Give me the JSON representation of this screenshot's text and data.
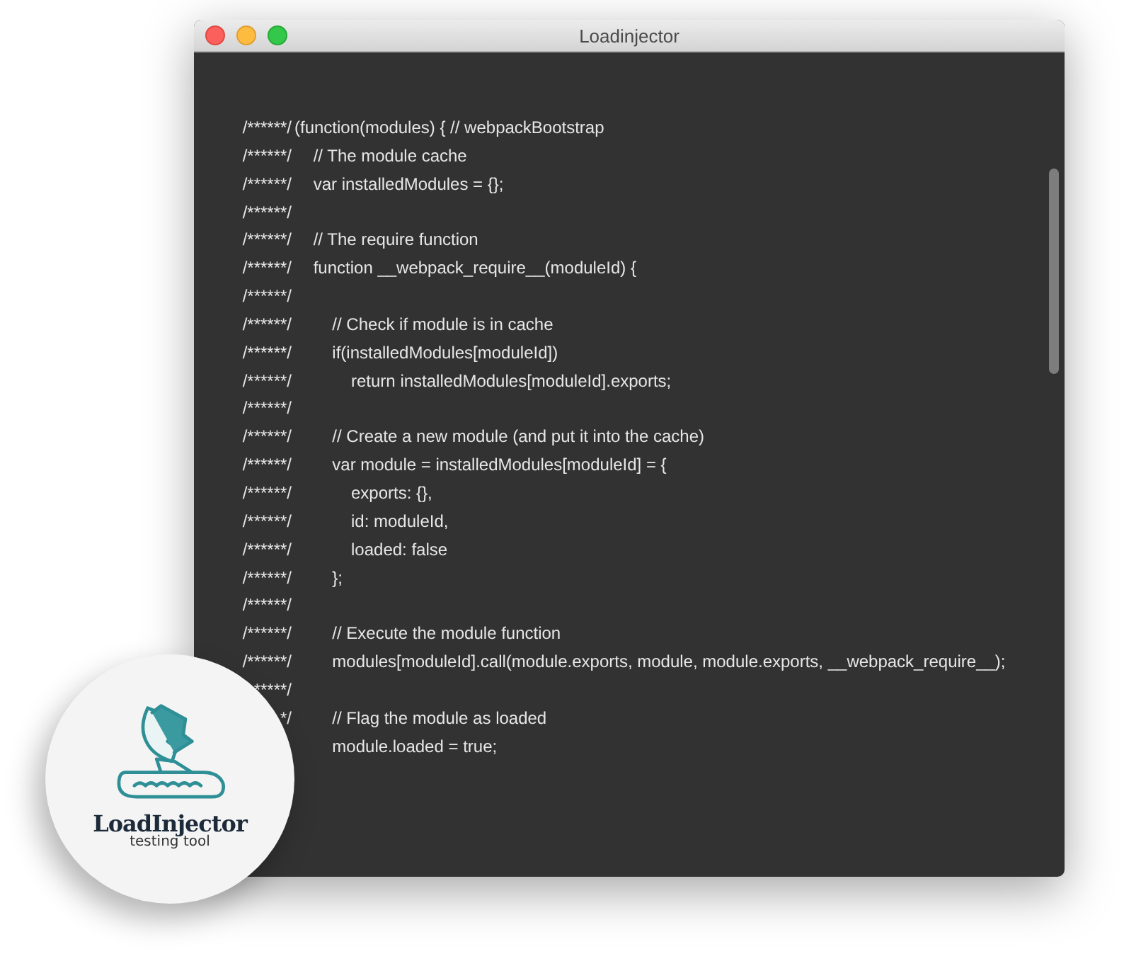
{
  "window": {
    "title": "Loadinjector"
  },
  "code_lines": [
    {
      "prefix": "/******/",
      "code": "(function(modules) { // webpackBootstrap"
    },
    {
      "prefix": "/******/",
      "code": "    // The module cache"
    },
    {
      "prefix": "/******/",
      "code": "    var installedModules = {};"
    },
    {
      "prefix": "/******/"
    },
    {
      "prefix": "/******/",
      "code": "    // The require function"
    },
    {
      "prefix": "/******/",
      "code": "    function __webpack_require__(moduleId) {"
    },
    {
      "prefix": "/******/"
    },
    {
      "prefix": "/******/",
      "code": "        // Check if module is in cache"
    },
    {
      "prefix": "/******/",
      "code": "        if(installedModules[moduleId])"
    },
    {
      "prefix": "/******/",
      "code": "            return installedModules[moduleId].exports;"
    },
    {
      "prefix": "/******/"
    },
    {
      "prefix": "/******/",
      "code": "        // Create a new module (and put it into the cache)"
    },
    {
      "prefix": "/******/",
      "code": "        var module = installedModules[moduleId] = {"
    },
    {
      "prefix": "/******/",
      "code": "            exports: {},"
    },
    {
      "prefix": "/******/",
      "code": "            id: moduleId,"
    },
    {
      "prefix": "/******/",
      "code": "            loaded: false"
    },
    {
      "prefix": "/******/",
      "code": "        };"
    },
    {
      "prefix": "/******/"
    },
    {
      "prefix": "/******/",
      "code": "        // Execute the module function"
    },
    {
      "prefix": "/******/",
      "code": "        modules[moduleId].call(module.exports, module, module.exports, __webpack_require__);"
    },
    {
      "prefix": "*****/"
    },
    {
      "prefix": "*/",
      "code": "        // Flag the module as loaded"
    },
    {
      "code": "        module.loaded = true;"
    }
  ],
  "badge": {
    "name": "LoadInjector",
    "tagline": "testing tool"
  }
}
